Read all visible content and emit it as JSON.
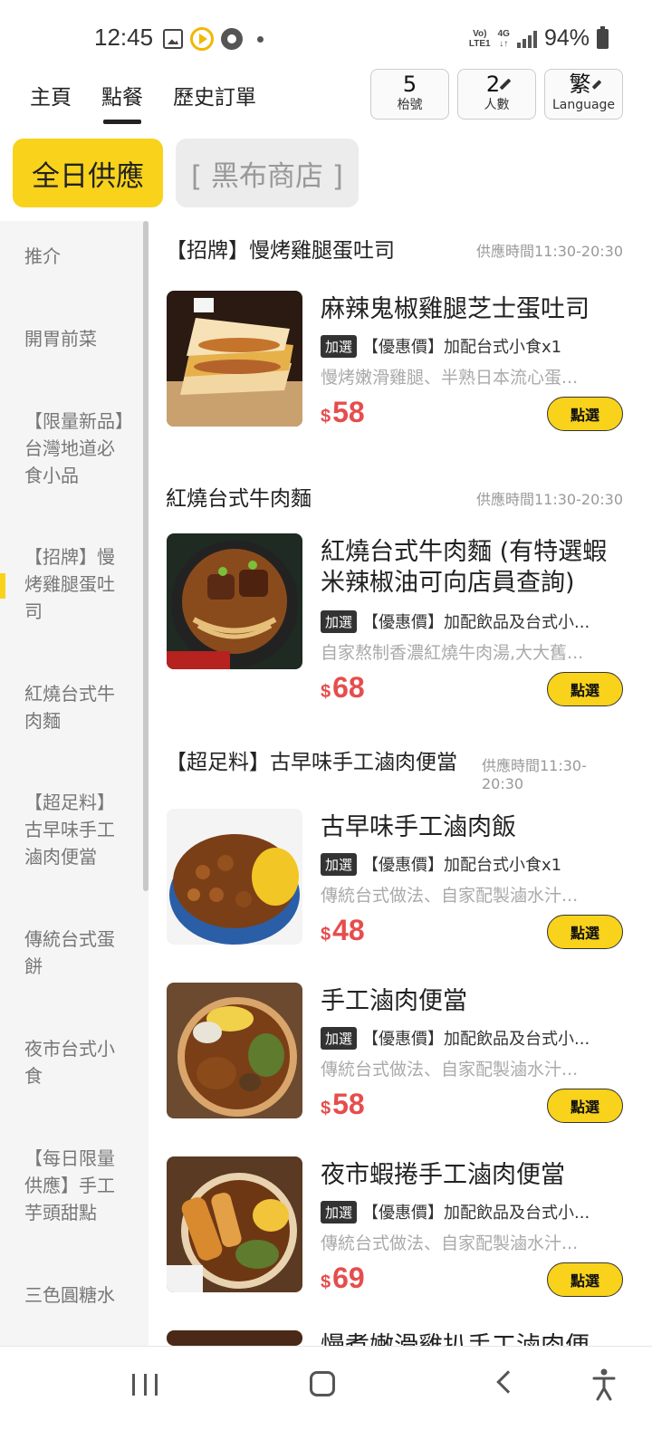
{
  "status": {
    "time": "12:45",
    "net_top": "Vo)",
    "net_bottom": "LTE1",
    "net_type": "4G",
    "battery": "94%"
  },
  "nav": {
    "tabs": [
      "主頁",
      "點餐",
      "歷史訂單"
    ],
    "active_tab": "點餐"
  },
  "chips": {
    "table_number": "5",
    "table_label": "枱號",
    "people_count": "2",
    "people_label": "人數",
    "language_value": "繁",
    "language_label": "Language"
  },
  "categories": {
    "active": "全日供應",
    "inactive": "[ 黑布商店 ]"
  },
  "sidebar": {
    "items": [
      "推介",
      "開胃前菜",
      "【限量新品】台灣地道必食小品",
      "【招牌】慢烤雞腿蛋吐司",
      "紅燒台式牛肉麵",
      "【超足料】古早味手工滷肉便當",
      "傳統台式蛋餅",
      "夜市台式小食",
      "【每日限量供應】手工芋頭甜點",
      "三色圓糖水"
    ],
    "active_index": 3
  },
  "sections": [
    {
      "title": "【招牌】慢烤雞腿蛋吐司",
      "time": "供應時間11:30-20:30",
      "items": [
        {
          "name": "麻辣鬼椒雞腿芝士蛋吐司",
          "tag": "加選",
          "promo": "【優惠價】加配台式小食x1",
          "desc": "慢烤嫩滑雞腿、半熟日本流心蛋...",
          "currency": "$",
          "price": "58",
          "button": "點選"
        }
      ]
    },
    {
      "title": "紅燒台式牛肉麵",
      "time": "供應時間11:30-20:30",
      "items": [
        {
          "name": "紅燒台式牛肉麵 (有特選蝦米辣椒油可向店員查詢)",
          "tag": "加選",
          "promo": "【優惠價】加配飲品及台式小...",
          "desc": "自家熬制香濃紅燒牛肉湯,大大舊...",
          "currency": "$",
          "price": "68",
          "button": "點選"
        }
      ]
    },
    {
      "title": "【超足料】古早味手工滷肉便當",
      "time": "供應時間11:30-20:30",
      "items": [
        {
          "name": "古早味手工滷肉飯",
          "tag": "加選",
          "promo": "【優惠價】加配台式小食x1",
          "desc": "傳統台式做法、自家配製滷水汁...",
          "currency": "$",
          "price": "48",
          "button": "點選"
        },
        {
          "name": "手工滷肉便當",
          "tag": "加選",
          "promo": "【優惠價】加配飲品及台式小...",
          "desc": "傳統台式做法、自家配製滷水汁...",
          "currency": "$",
          "price": "58",
          "button": "點選"
        },
        {
          "name": "夜市蝦捲手工滷肉便當",
          "tag": "加選",
          "promo": "【優惠價】加配飲品及台式小...",
          "desc": "傳統台式做法、自家配製滷水汁...",
          "currency": "$",
          "price": "69",
          "button": "點選"
        }
      ]
    }
  ],
  "partial_next_item": "慢煮嫩滑雞扒手工滷肉便",
  "colors": {
    "accent": "#f8d21b",
    "price": "#e64d4d",
    "sidebar_bg": "#f5f5f5"
  }
}
